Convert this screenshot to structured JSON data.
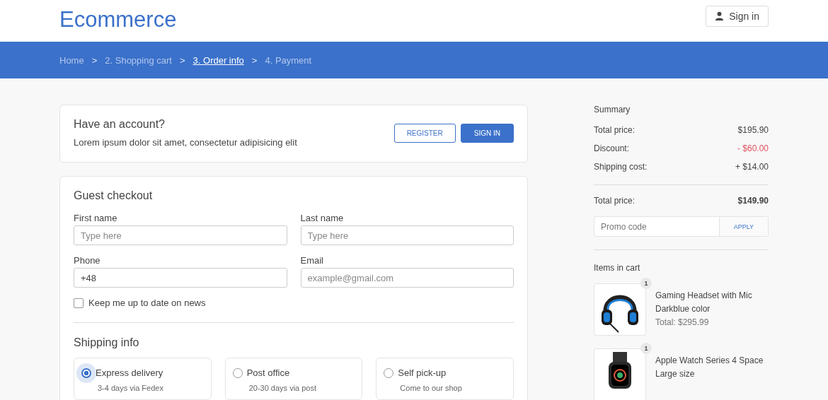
{
  "header": {
    "logo": "Ecommerce",
    "sign_in": "Sign in"
  },
  "breadcrumb": [
    {
      "kind": "link",
      "label": "Home",
      "selected": false
    },
    {
      "kind": "separator",
      "label": ">"
    },
    {
      "kind": "link",
      "label": "2. Shopping cart",
      "selected": false
    },
    {
      "kind": "separator",
      "label": ">"
    },
    {
      "kind": "link",
      "label": "3. Order info",
      "selected": true
    },
    {
      "kind": "separator",
      "label": ">"
    },
    {
      "kind": "link",
      "label": "4. Payment",
      "selected": false
    }
  ],
  "account": {
    "title": "Have an account?",
    "text": "Lorem ipsum dolor sit amet, consectetur adipisicing elit",
    "register": "REGISTER",
    "sign_in": "SIGN IN"
  },
  "guest": {
    "title": "Guest checkout",
    "fields": [
      {
        "label": "First name",
        "placeholder": "Type here"
      },
      {
        "label": "Last name",
        "placeholder": "Type here"
      },
      {
        "label": "Phone",
        "value": "+48"
      },
      {
        "label": "Email",
        "placeholder": "example@gmail.com"
      }
    ],
    "newsletter": {
      "label": "Keep me up to date on news",
      "checked": false
    }
  },
  "shipping": {
    "title": "Shipping info",
    "options": [
      {
        "label": "Express delivery",
        "note": "3-4 days via Fedex",
        "selected": true
      },
      {
        "label": "Post office",
        "note": "20-30 days via post",
        "selected": false
      },
      {
        "label": "Self pick-up",
        "note": "Come to our shop",
        "selected": false
      }
    ]
  },
  "summary": {
    "title": "Summary",
    "rows": [
      {
        "label": "Total price:",
        "value": "$195.90",
        "kind": "plain"
      },
      {
        "label": "Discount:",
        "value": "- $60.00",
        "kind": "discount"
      },
      {
        "label": "Shipping cost:",
        "value": "+ $14.00",
        "kind": "plain"
      }
    ],
    "total": {
      "label": "Total price:",
      "value": "$149.90"
    },
    "promo": {
      "placeholder": "Promo code",
      "button": "APPLY"
    }
  },
  "cart": {
    "title": "Items in cart",
    "items": [
      {
        "kind": "headset",
        "quantity": "1",
        "name": "Gaming Headset with Mic",
        "variant": "Darkblue color",
        "total": "Total: $295.99"
      },
      {
        "kind": "watch",
        "quantity": "1",
        "name": "Apple Watch Series 4 Space",
        "variant": "Large size"
      }
    ]
  }
}
